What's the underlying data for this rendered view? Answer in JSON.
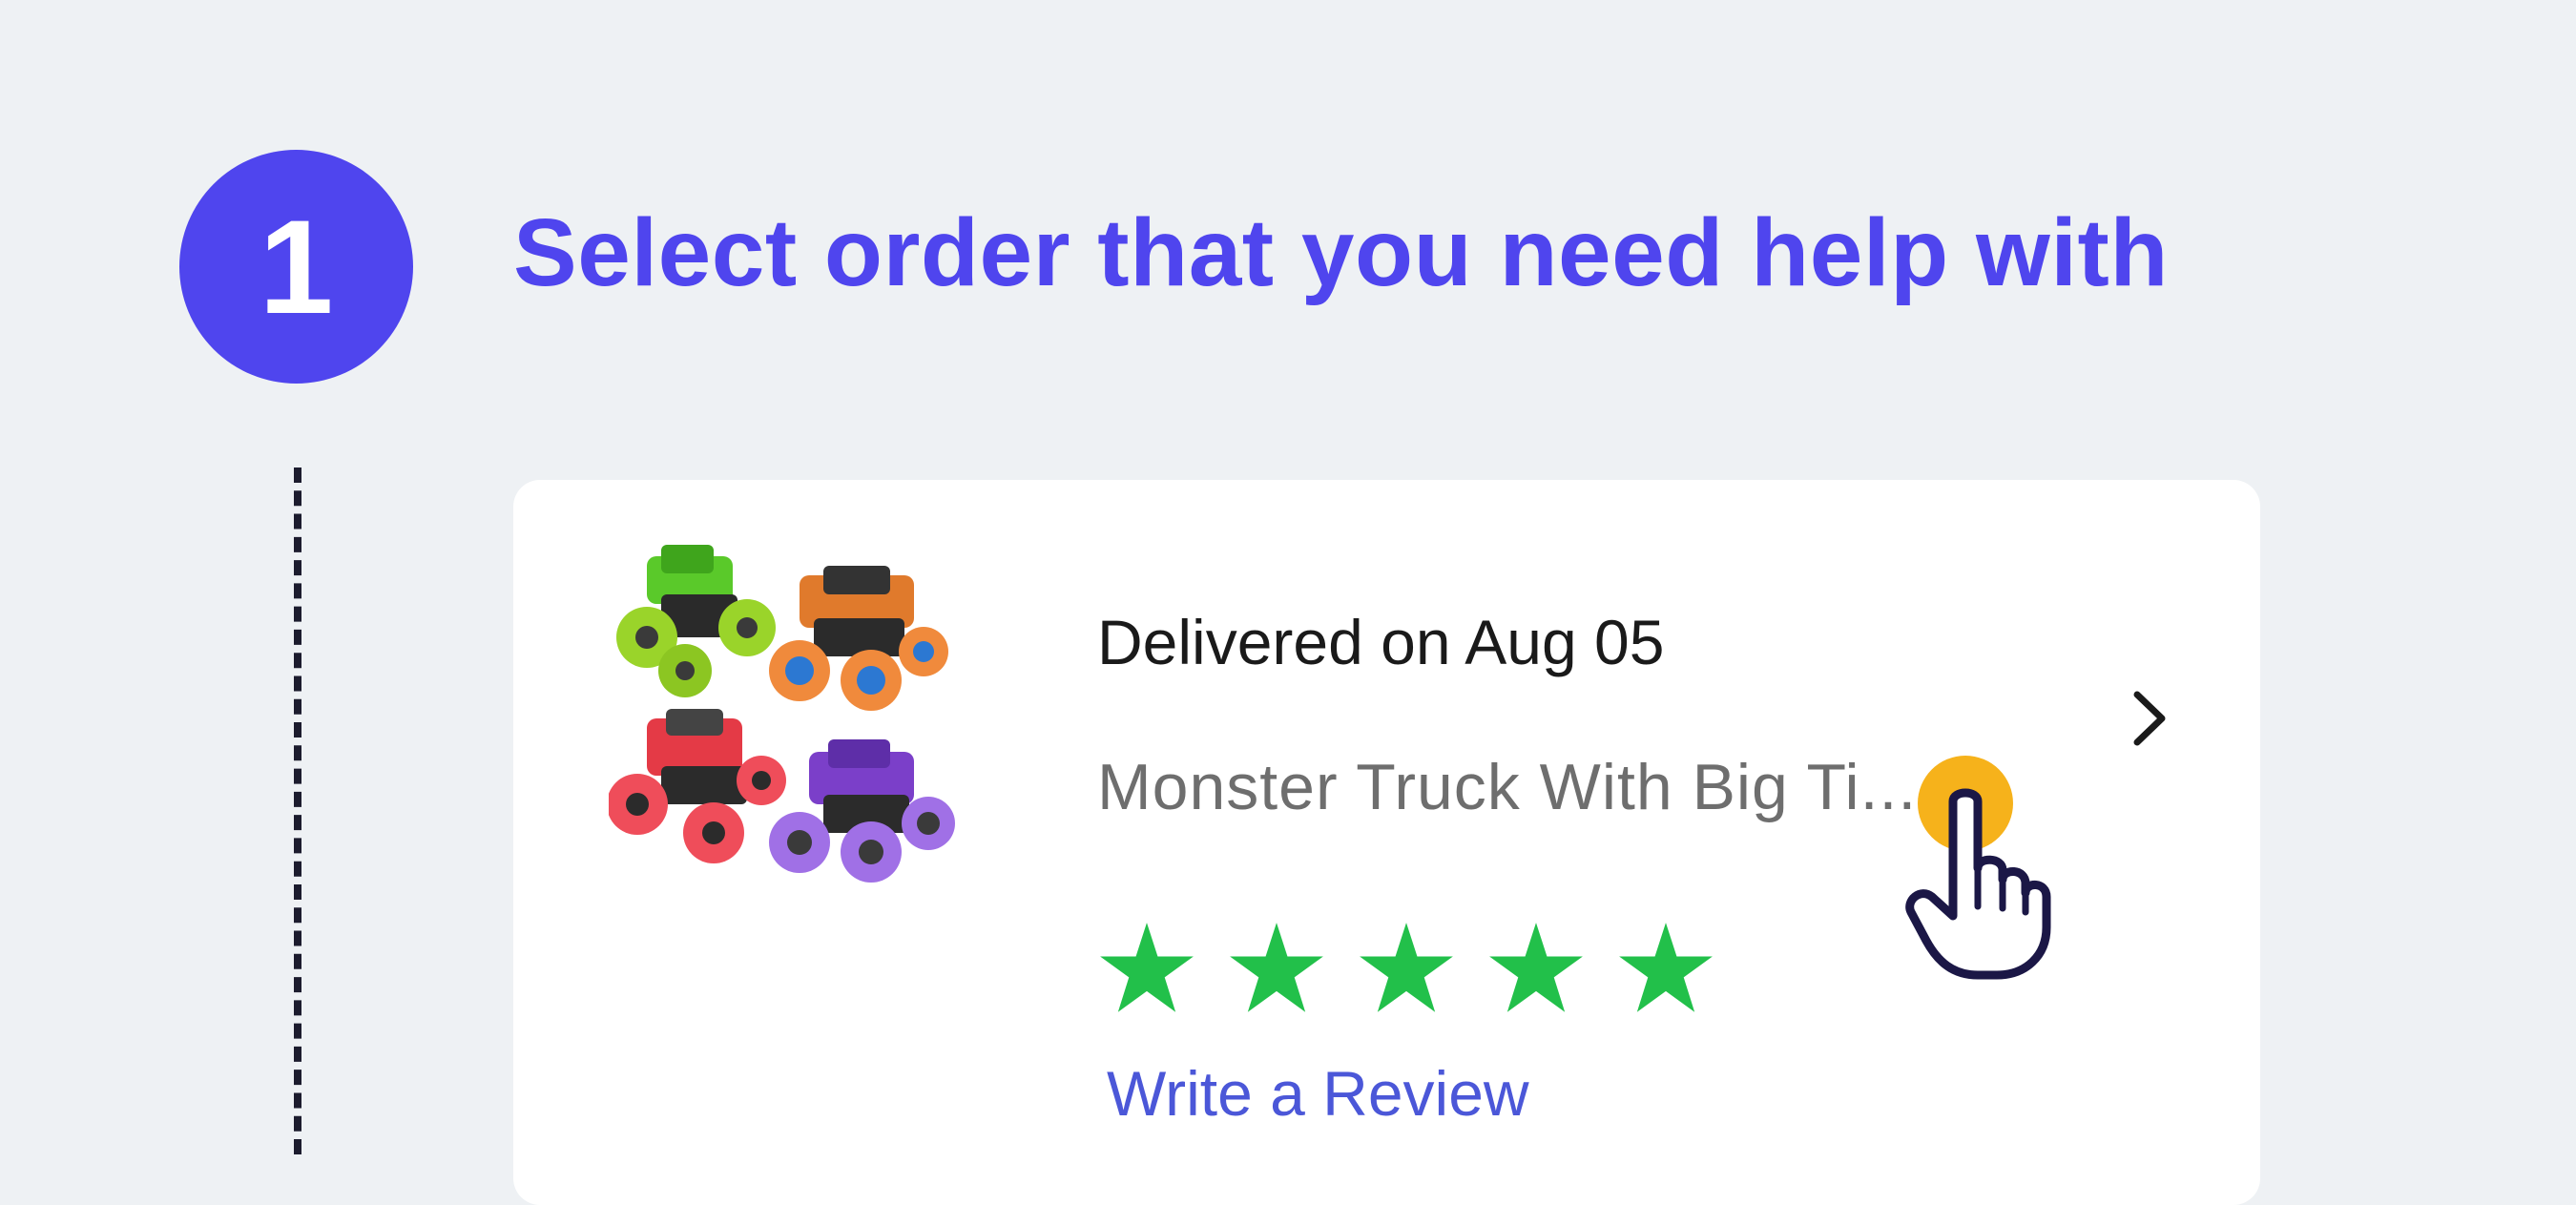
{
  "step": {
    "number": "1",
    "title": "Select order that you need help with"
  },
  "order_card": {
    "delivery_status": "Delivered on Aug 05",
    "product_name": "Monster Truck With Big Ti...",
    "rating": 5,
    "rating_max": 5,
    "review_link": "Write a Review",
    "product_image_icon": "monster-trucks-product-image",
    "chevron_icon": "chevron-right-icon"
  },
  "cursor": {
    "icon": "hand-pointer-icon",
    "highlight_color": "#f6b21b"
  },
  "colors": {
    "accent": "#4f45ee",
    "star": "#22c04a",
    "link": "#4b57d8",
    "background": "#eef1f4"
  }
}
